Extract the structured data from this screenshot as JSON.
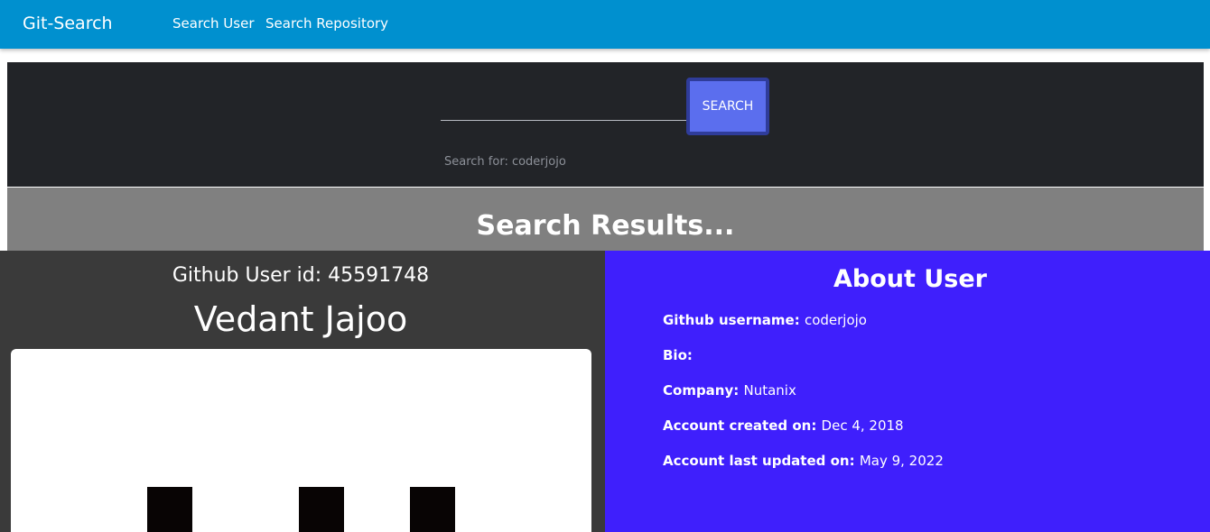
{
  "nav": {
    "brand": "Git-Search",
    "links": [
      "Search User",
      "Search Repository"
    ]
  },
  "search": {
    "value": "",
    "placeholder": "",
    "button_label": "SEARCH",
    "hint": "Search for: coderjojo"
  },
  "results": {
    "title": "Search Results..."
  },
  "user": {
    "id_text": "Github User id: 45591748",
    "name": "Vedant Jajoo"
  },
  "about": {
    "title": "About User",
    "fields": [
      {
        "label": "Github username:",
        "value": "coderjojo"
      },
      {
        "label": "Bio:",
        "value": ""
      },
      {
        "label": "Company:",
        "value": "Nutanix"
      },
      {
        "label": "Account created on:",
        "value": "Dec 4, 2018"
      },
      {
        "label": "Account last updated on:",
        "value": "May 9, 2022"
      }
    ]
  },
  "colors": {
    "navbar": "#0090cf",
    "search_panel": "#222428",
    "search_button": "#5b6eee",
    "results_bar": "#808080",
    "left_panel": "#3a3a3a",
    "right_panel": "#3f1ffc"
  }
}
